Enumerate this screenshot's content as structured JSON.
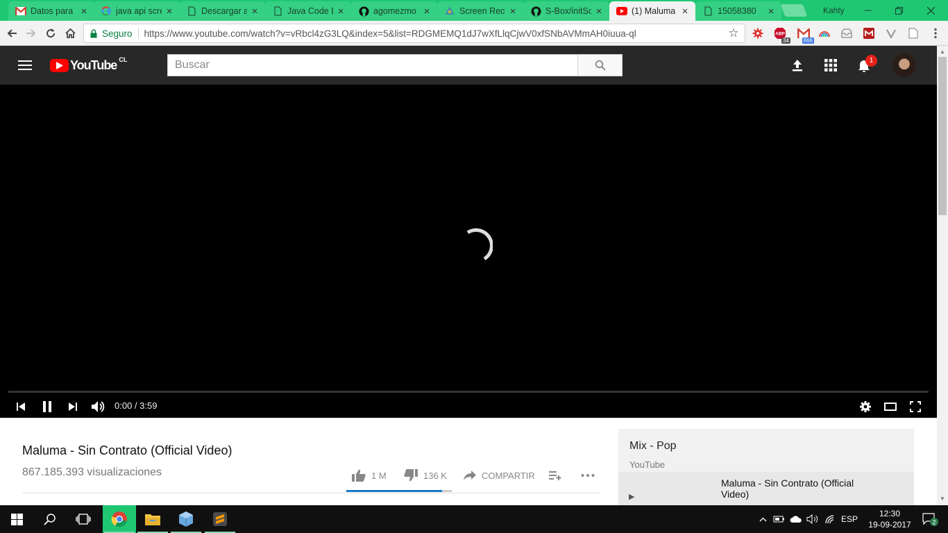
{
  "browser": {
    "tabs": [
      {
        "title": "Datos para",
        "icon": "gmail-icon"
      },
      {
        "title": "java api scre",
        "icon": "google-icon"
      },
      {
        "title": "Descargar a",
        "icon": "page-icon"
      },
      {
        "title": "Java Code E",
        "icon": "page-icon"
      },
      {
        "title": "agomezmo",
        "icon": "github-icon"
      },
      {
        "title": "Screen Reco",
        "icon": "screen-recorder-icon"
      },
      {
        "title": "S-Box/initSc",
        "icon": "github-icon"
      },
      {
        "title": "(1) Maluma",
        "icon": "youtube-icon",
        "active": true
      },
      {
        "title": "15058380",
        "icon": "page-icon"
      }
    ],
    "profile_name": "Kahty",
    "secure_label": "Seguro",
    "url": "https://www.youtube.com/watch?v=vRbcl4zG3LQ&index=5&list=RDGMEMQ1dJ7wXfLlqCjwV0xfSNbAVMmAH0iuua-ql",
    "extensions": [
      {
        "name": "extension-gear-icon"
      },
      {
        "name": "abp-icon",
        "badge": "34"
      },
      {
        "name": "gmail-checker-icon",
        "badge": "866"
      },
      {
        "name": "rainbow-icon"
      },
      {
        "name": "inbox-icon"
      },
      {
        "name": "m-extension-icon"
      },
      {
        "name": "vimeo-icon"
      },
      {
        "name": "document-icon"
      }
    ],
    "menu_icon": "chrome-menu-icon"
  },
  "youtube": {
    "logo_text": "YouTube",
    "country_code": "CL",
    "search_placeholder": "Buscar",
    "notification_count": "1",
    "player": {
      "current_time": "0:00",
      "duration": "3:59",
      "time_display": "0:00 / 3:59",
      "progress_fraction": 0,
      "state": "loading"
    },
    "video": {
      "title": "Maluma - Sin Contrato (Official Video)",
      "views": "867.185.393 visualizaciones",
      "likes": "1 M",
      "dislikes": "136 K",
      "share_label": "COMPARTIR",
      "like_fraction": 0.91
    },
    "playlist": {
      "title": "Mix - Pop",
      "owner": "YouTube",
      "items": [
        {
          "title": "Maluma - Sin Contrato (Official Video)"
        }
      ]
    }
  },
  "taskbar": {
    "apps": [
      "windows-start-icon",
      "search-icon",
      "task-view-icon",
      "chrome-icon",
      "file-explorer-icon",
      "virtualbox-icon",
      "sublime-icon"
    ],
    "language": "ESP",
    "time": "12:30",
    "date": "19-09-2017",
    "notifications_count": "2"
  },
  "colors": {
    "chrome_frame": "#1fc773",
    "youtube_red": "#ff0000",
    "masthead": "#282828"
  }
}
